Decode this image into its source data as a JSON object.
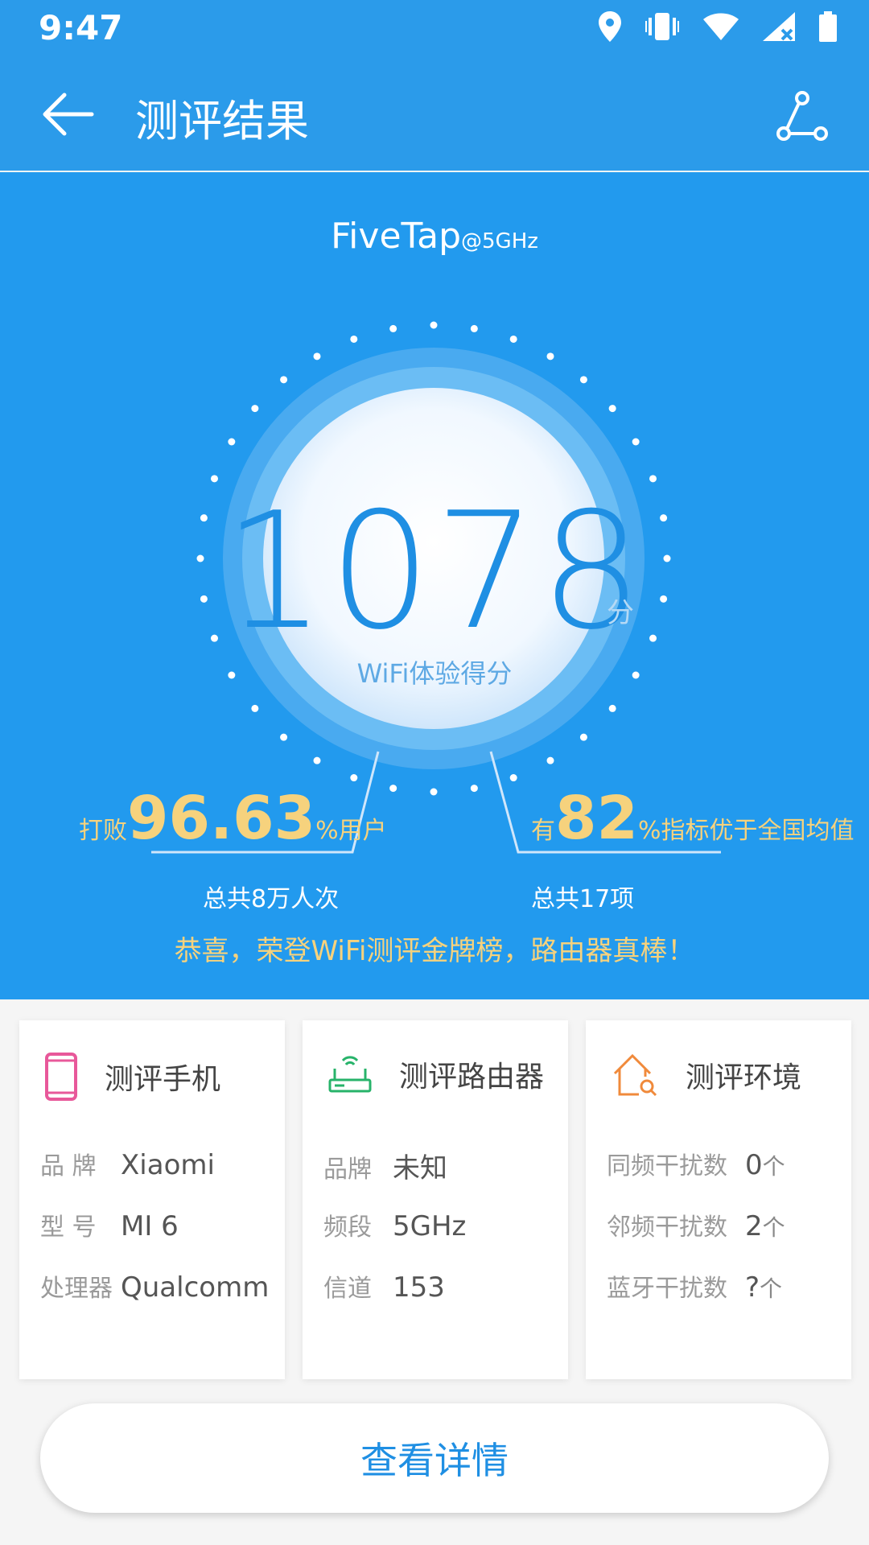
{
  "status_bar": {
    "time": "9:47"
  },
  "app_bar": {
    "title": "测评结果"
  },
  "hero": {
    "ssid": "FiveTap",
    "band": "@5GHz",
    "score": "1078",
    "score_unit": "分",
    "score_label": "WiFi体验得分",
    "beat_prefix": "打败",
    "beat_value": "96.63",
    "beat_suffix": "%用户",
    "beat_total": "总共8万人次",
    "better_prefix": "有",
    "better_value": "82",
    "better_suffix": "%指标优于全国均值",
    "better_total": "总共17项",
    "congrats": "恭喜，荣登WiFi测评金牌榜，路由器真棒！"
  },
  "cards": {
    "phone": {
      "title": "测评手机",
      "rows": [
        {
          "key": "品  牌",
          "value": "Xiaomi"
        },
        {
          "key": "型  号",
          "value": "MI 6"
        },
        {
          "key": "处理器",
          "value": "Qualcomm"
        }
      ]
    },
    "router": {
      "title": "测评路由器",
      "rows": [
        {
          "key": "品牌",
          "value": "未知"
        },
        {
          "key": "频段",
          "value": "5GHz"
        },
        {
          "key": "信道",
          "value": "153"
        }
      ]
    },
    "environment": {
      "title": "测评环境",
      "unit": "个",
      "rows": [
        {
          "key": "同频干扰数",
          "value": "0"
        },
        {
          "key": "邻频干扰数",
          "value": "2"
        },
        {
          "key": "蓝牙干扰数",
          "value": "?"
        }
      ]
    }
  },
  "detail_button": {
    "label": "查看详情"
  },
  "colors": {
    "primary": "#229aee",
    "accent": "#f6d27d",
    "score": "#1f8fe3"
  },
  "icons": [
    "location-icon",
    "vibrate-icon",
    "wifi-icon",
    "signal-icon",
    "battery-icon",
    "back-arrow-icon",
    "share-icon",
    "phone-icon",
    "router-icon",
    "home-search-icon"
  ]
}
